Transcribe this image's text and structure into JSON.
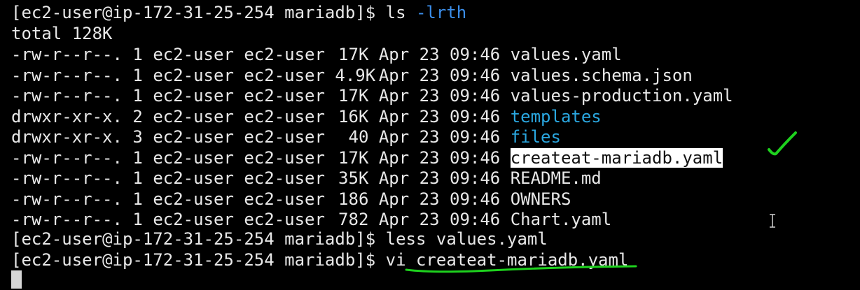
{
  "prompt": "[ec2-user@ip-172-31-25-254 mariadb]$ ",
  "commands": {
    "ls": "ls",
    "ls_flag": "-lrth",
    "less": "less values.yaml",
    "vi": "vi createat-mariadb.yaml"
  },
  "total_line": "total 128K",
  "listing": [
    {
      "perms": "-rw-r--r--.",
      "links": "1",
      "owner": "ec2-user",
      "group": "ec2-user",
      "size": "17K",
      "date": "Apr 23 09:46",
      "name": "values.yaml",
      "type": "file"
    },
    {
      "perms": "-rw-r--r--.",
      "links": "1",
      "owner": "ec2-user",
      "group": "ec2-user",
      "size": "4.9K",
      "date": "Apr 23 09:46",
      "name": "values.schema.json",
      "type": "file"
    },
    {
      "perms": "-rw-r--r--.",
      "links": "1",
      "owner": "ec2-user",
      "group": "ec2-user",
      "size": "17K",
      "date": "Apr 23 09:46",
      "name": "values-production.yaml",
      "type": "file"
    },
    {
      "perms": "drwxr-xr-x.",
      "links": "2",
      "owner": "ec2-user",
      "group": "ec2-user",
      "size": "16K",
      "date": "Apr 23 09:46",
      "name": "templates",
      "type": "dir"
    },
    {
      "perms": "drwxr-xr-x.",
      "links": "3",
      "owner": "ec2-user",
      "group": "ec2-user",
      "size": "40",
      "date": "Apr 23 09:46",
      "name": "files",
      "type": "dir"
    },
    {
      "perms": "-rw-r--r--.",
      "links": "1",
      "owner": "ec2-user",
      "group": "ec2-user",
      "size": "17K",
      "date": "Apr 23 09:46",
      "name": "createat-mariadb.yaml",
      "type": "highlighted"
    },
    {
      "perms": "-rw-r--r--.",
      "links": "1",
      "owner": "ec2-user",
      "group": "ec2-user",
      "size": "35K",
      "date": "Apr 23 09:46",
      "name": "README.md",
      "type": "file"
    },
    {
      "perms": "-rw-r--r--.",
      "links": "1",
      "owner": "ec2-user",
      "group": "ec2-user",
      "size": "186",
      "date": "Apr 23 09:46",
      "name": "OWNERS",
      "type": "file"
    },
    {
      "perms": "-rw-r--r--.",
      "links": "1",
      "owner": "ec2-user",
      "group": "ec2-user",
      "size": "782",
      "date": "Apr 23 09:46",
      "name": "Chart.yaml",
      "type": "file"
    }
  ],
  "colors": {
    "background": "#000000",
    "text": "#e8e8e8",
    "directory": "#2aa7e0",
    "annotation": "#1ed21e",
    "highlight_bg": "#ffffff"
  }
}
